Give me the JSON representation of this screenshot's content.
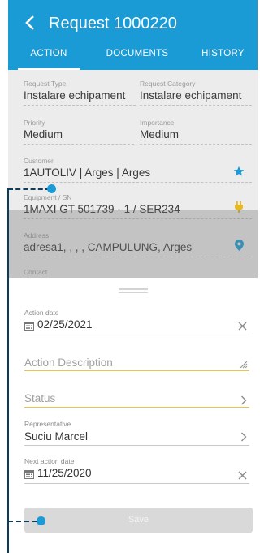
{
  "header": {
    "title": "Request 1000220",
    "tabs": [
      {
        "label": "ACTION",
        "active": true
      },
      {
        "label": "DOCUMENTS",
        "active": false
      },
      {
        "label": "HISTORY",
        "active": false
      }
    ]
  },
  "details": {
    "request_type": {
      "label": "Request Type",
      "value": "Instalare echipament"
    },
    "request_category": {
      "label": "Request Category",
      "value": "Instalare echipament"
    },
    "priority": {
      "label": "Priority",
      "value": "Medium"
    },
    "importance": {
      "label": "Importance",
      "value": "Medium"
    },
    "customer": {
      "label": "Customer",
      "value": "1AUTOLIV | Arges | Arges"
    },
    "equipment": {
      "label": "Equipment / SN",
      "value": "1MAXI GT 501739 - 1 / SER234"
    },
    "address": {
      "label": "Address",
      "value": "adresa1, , , , CAMPULUNG, Arges"
    },
    "contact": {
      "label": "Contact"
    }
  },
  "sheet": {
    "action_date": {
      "label": "Action date",
      "value": "02/25/2021"
    },
    "action_description": {
      "placeholder": "Action Description"
    },
    "status": {
      "placeholder": "Status"
    },
    "representative": {
      "label": "Representative",
      "value": "Suciu Marcel"
    },
    "next_action_date": {
      "label": "Next action date",
      "value": "11/25/2020"
    },
    "save_label": "Save"
  },
  "colors": {
    "header": "#1a9bd6",
    "accent": "#1a9bd6",
    "annotation_line": "#0d3c5a",
    "field_underline_active": "#e6c74a"
  },
  "icons": [
    "back-chevron-icon",
    "star-icon",
    "plug-icon",
    "location-pin-icon",
    "calendar-icon",
    "clear-icon",
    "resize-icon",
    "chevron-right-icon"
  ]
}
